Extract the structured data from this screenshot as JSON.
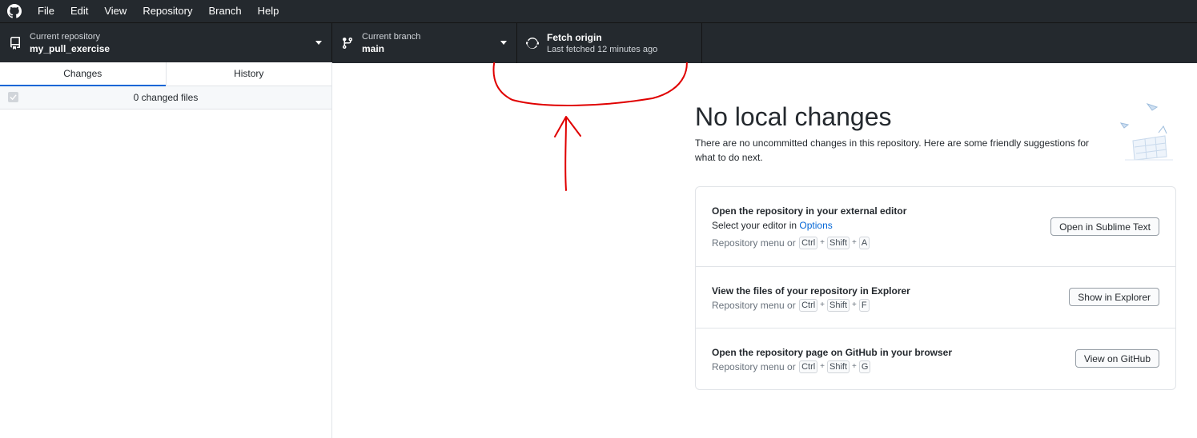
{
  "menu": {
    "logo_icon": "github-octocat-icon",
    "items": [
      "File",
      "Edit",
      "View",
      "Repository",
      "Branch",
      "Help"
    ]
  },
  "toolbar": {
    "repository": {
      "label": "Current repository",
      "value": "my_pull_exercise",
      "icon": "repo-icon"
    },
    "branch": {
      "label": "Current branch",
      "value": "main",
      "icon": "git-branch-icon"
    },
    "fetch": {
      "title": "Fetch origin",
      "subtitle": "Last fetched 12 minutes ago",
      "icon": "sync-icon"
    }
  },
  "sidebar": {
    "tabs": [
      {
        "label": "Changes",
        "active": true
      },
      {
        "label": "History",
        "active": false
      }
    ],
    "changes_count": "0 changed files"
  },
  "main": {
    "title": "No local changes",
    "description": "There are no uncommitted changes in this repository. Here are some friendly suggestions for what to do next.",
    "suggestions": [
      {
        "title": "Open the repository in your external editor",
        "line_prefix": "Select your editor in ",
        "line_link": "Options",
        "hint": "Repository menu or",
        "keys": [
          "Ctrl",
          "Shift",
          "A"
        ],
        "button": "Open in Sublime Text"
      },
      {
        "title": "View the files of your repository in Explorer",
        "hint": "Repository menu or",
        "keys": [
          "Ctrl",
          "Shift",
          "F"
        ],
        "button": "Show in Explorer"
      },
      {
        "title": "Open the repository page on GitHub in your browser",
        "hint": "Repository menu or",
        "keys": [
          "Ctrl",
          "Shift",
          "G"
        ],
        "button": "View on GitHub"
      }
    ]
  },
  "colors": {
    "toolbar_bg": "#24292e",
    "accent": "#0366d6",
    "annotation": "#e00000"
  }
}
